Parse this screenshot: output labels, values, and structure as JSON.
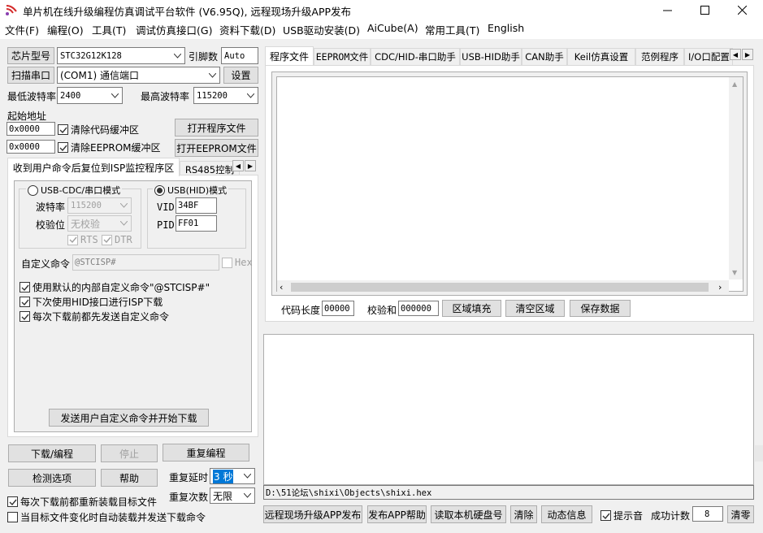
{
  "window": {
    "title": "单片机在线升级编程仿真调试平台软件 (V6.95Q), 远程现场升级APP发布",
    "minimize_glyph": "—",
    "maximize_glyph": "☐",
    "close_glyph": "✕"
  },
  "menu": [
    "文件(F)",
    "编程(O)",
    "工具(T)",
    "调试仿真接口(G)",
    "资料下载(D)",
    "USB驱动安装(D)",
    "AiCube(A)",
    "常用工具(T)",
    "English"
  ],
  "left": {
    "chip_type_btn": "芯片型号",
    "chip_type_value": "STC32G12K128",
    "pins_label": "引脚数",
    "pins_value": "Auto",
    "scan_port_btn": "扫描串口",
    "port_value": "(COM1) 通信端口",
    "settings_btn": "设置",
    "min_baud_label": "最低波特率",
    "min_baud_value": "2400",
    "max_baud_label": "最高波特率",
    "max_baud_value": "115200",
    "start_addr_label": "起始地址",
    "code_addr_value": "0x0000",
    "clear_code_label": "清除代码缓冲区",
    "open_program_btn": "打开程序文件",
    "eeprom_addr_value": "0x0000",
    "clear_eeprom_label": "清除EEPROM缓冲区",
    "open_eeprom_btn": "打开EEPROM文件",
    "tabs": [
      "收到用户命令后复位到ISP监控程序区",
      "RS485控制"
    ],
    "usb_cdc_label": "USB-CDC/串口模式",
    "baud_label": "波特率",
    "baud_value": "115200",
    "parity_label": "校验位",
    "parity_value": "无校验",
    "rts_label": "RTS",
    "dtr_label": "DTR",
    "usb_hid_label": "USB(HID)模式",
    "vid_label": "VID",
    "vid_value": "34BF",
    "pid_label": "PID",
    "pid_value": "FF01",
    "custom_cmd_label": "自定义命令",
    "custom_cmd_value": "@STCISP#",
    "hex_label": "Hex",
    "use_default_cmd_label": "使用默认的内部自定义命令\"@STCISP#\"",
    "next_hid_label": "下次使用HID接口进行ISP下载",
    "send_before_label": "每次下载前都先发送自定义命令",
    "send_and_download_btn": "发送用户自定义命令并开始下载",
    "download_btn": "下载/编程",
    "stop_btn": "停止",
    "reprogram_btn": "重复编程",
    "check_options_btn": "检测选项",
    "help_btn": "帮助",
    "repeat_delay_label": "重复延时",
    "repeat_delay_value": "3 秒",
    "repeat_count_label": "重复次数",
    "repeat_count_value": "无限",
    "reload_label": "每次下载前都重新装载目标文件",
    "auto_send_label": "当目标文件变化时自动装载并发送下载命令"
  },
  "right": {
    "tabs": [
      "程序文件",
      "EEPROM文件",
      "CDC/HID-串口助手",
      "USB-HID助手",
      "CAN助手",
      "Keil仿真设置",
      "范例程序",
      "I/O口配置"
    ],
    "code_len_label": "代码长度",
    "code_len_value": "00000",
    "checksum_label": "校验和",
    "checksum_value": "000000",
    "fill_btn": "区域填充",
    "clear_btn": "清空区域",
    "save_btn": "保存数据",
    "file_path": "D:\\51论坛\\shixi\\Objects\\shixi.hex",
    "remote_upgrade_btn": "远程现场升级APP发布",
    "publish_help_btn": "发布APP帮助",
    "read_disk_btn": "读取本机硬盘号",
    "clear_log_btn": "清除",
    "dynamic_info_btn": "动态信息",
    "prompt_sound_label": "提示音",
    "success_count_label": "成功计数",
    "success_count_value": "8",
    "reset_count_btn": "清零"
  },
  "colors": {
    "window_bg": "#f0f0f0",
    "border": "#adadad",
    "disabled_text": "#a0a0a0"
  },
  "icons": [
    "app-logo-icon",
    "chevron-down-icon",
    "check-icon",
    "arrow-left-icon",
    "arrow-right-icon"
  ]
}
